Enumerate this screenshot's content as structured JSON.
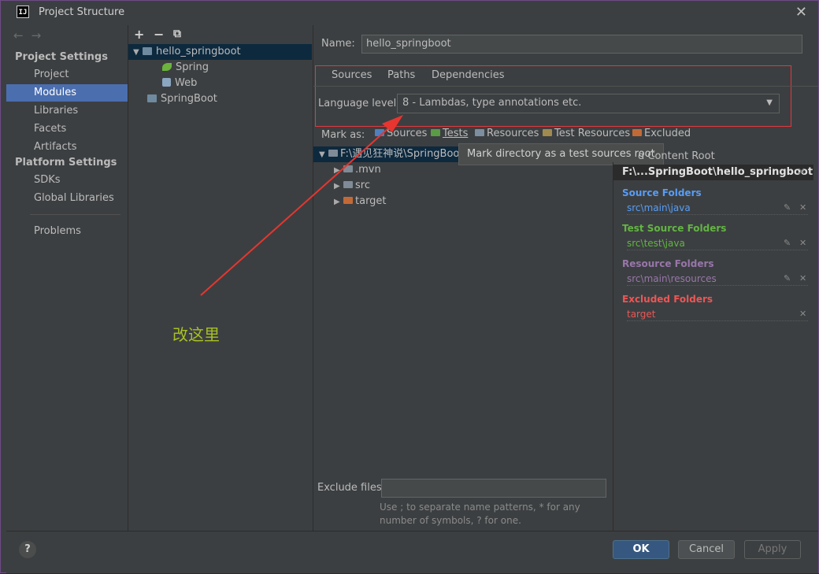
{
  "window": {
    "title": "Project Structure",
    "app_icon": "IJ"
  },
  "left_nav": {
    "project_settings_header": "Project Settings",
    "items_ps": [
      "Project",
      "Modules",
      "Libraries",
      "Facets",
      "Artifacts"
    ],
    "platform_settings_header": "Platform Settings",
    "items_platform": [
      "SDKs",
      "Global Libraries"
    ],
    "problems": "Problems",
    "selected": "Modules"
  },
  "module_tree": {
    "toolbar": {
      "add": "+",
      "remove": "−",
      "copy": "⧉"
    },
    "nodes": {
      "root": "hello_springboot",
      "spring": "Spring",
      "web": "Web",
      "other": "SpringBoot"
    }
  },
  "main": {
    "name_label": "Name:",
    "name_value": "hello_springboot",
    "tabs": [
      "Sources",
      "Paths",
      "Dependencies"
    ],
    "language_level_label": "Language level:",
    "language_level_value": "8 - Lambdas, type annotations etc.",
    "mark_as_label": "Mark as:",
    "mark_buttons": [
      "Sources",
      "Tests",
      "Resources",
      "Test Resources",
      "Excluded"
    ],
    "tooltip": "Mark directory as a test sources root",
    "dir_tree": {
      "root": "F:\\遇见狂神说\\SpringBoo",
      "children": [
        ".mvn",
        "src",
        "target"
      ]
    },
    "exclude_files_label": "Exclude files:",
    "exclude_hint": "Use ; to separate name patterns, * for any number of symbols, ? for one."
  },
  "right_panel": {
    "add_content_root": "d Content Root",
    "header": "F:\\...SpringBoot\\hello_springboot",
    "source_folders": {
      "title": "Source Folders",
      "path": "src\\main\\java",
      "color": "#589df6"
    },
    "test_source_folders": {
      "title": "Test Source Folders",
      "path": "src\\test\\java",
      "color": "#62b543"
    },
    "resource_folders": {
      "title": "Resource Folders",
      "path": "src\\main\\resources",
      "color": "#9876aa"
    },
    "excluded_folders": {
      "title": "Excluded Folders",
      "path": "target",
      "color": "#ec5656"
    }
  },
  "annotation": "改这里",
  "buttons": {
    "ok": "OK",
    "cancel": "Cancel",
    "apply": "Apply",
    "help": "?"
  }
}
